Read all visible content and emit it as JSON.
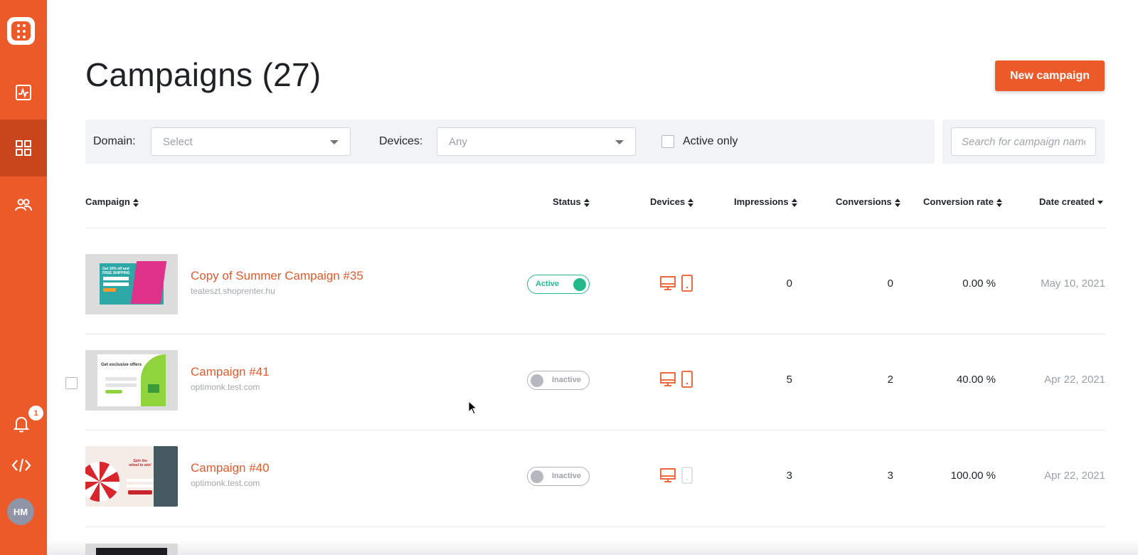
{
  "sidebar": {
    "items": [
      {
        "name": "analytics",
        "icon": "activity-chart-icon",
        "active": false
      },
      {
        "name": "campaigns",
        "icon": "grid-icon",
        "active": true
      },
      {
        "name": "subscribers",
        "icon": "users-icon",
        "active": false
      }
    ],
    "notifications_count": "1",
    "avatar_initials": "HM",
    "accent_color": "#ed5a29"
  },
  "header": {
    "title": "Campaigns (27)",
    "new_campaign_label": "New campaign"
  },
  "filters": {
    "domain_label": "Domain:",
    "domain_value": "Select",
    "devices_label": "Devices:",
    "devices_value": "Any",
    "active_only_label": "Active only",
    "search_placeholder": "Search for campaign name"
  },
  "table": {
    "columns": {
      "campaign": "Campaign",
      "status": "Status",
      "devices": "Devices",
      "impressions": "Impressions",
      "conversions": "Conversions",
      "conversion_rate": "Conversion rate",
      "date_created": "Date created"
    },
    "rows": [
      {
        "name": "Copy of Summer Campaign #35",
        "domain": "teateszt.shoprenter.hu",
        "status": "Active",
        "desktop": true,
        "mobile": true,
        "impressions": "0",
        "conversions": "0",
        "conversion_rate": "0.00 %",
        "date": "May 10, 2021",
        "thumb_text": "Get 10% off and FREE SHIPPING"
      },
      {
        "name": "Campaign #41",
        "domain": "optimonk.test.com",
        "status": "Inactive",
        "desktop": true,
        "mobile": true,
        "impressions": "5",
        "conversions": "2",
        "conversion_rate": "40.00 %",
        "date": "Apr 22, 2021",
        "thumb_text": "Get exclusive offers"
      },
      {
        "name": "Campaign #40",
        "domain": "optimonk.test.com",
        "status": "Inactive",
        "desktop": true,
        "mobile": false,
        "impressions": "3",
        "conversions": "3",
        "conversion_rate": "100.00 %",
        "date": "Apr 22, 2021",
        "thumb_text": "Spin the wheel to win!"
      }
    ]
  }
}
